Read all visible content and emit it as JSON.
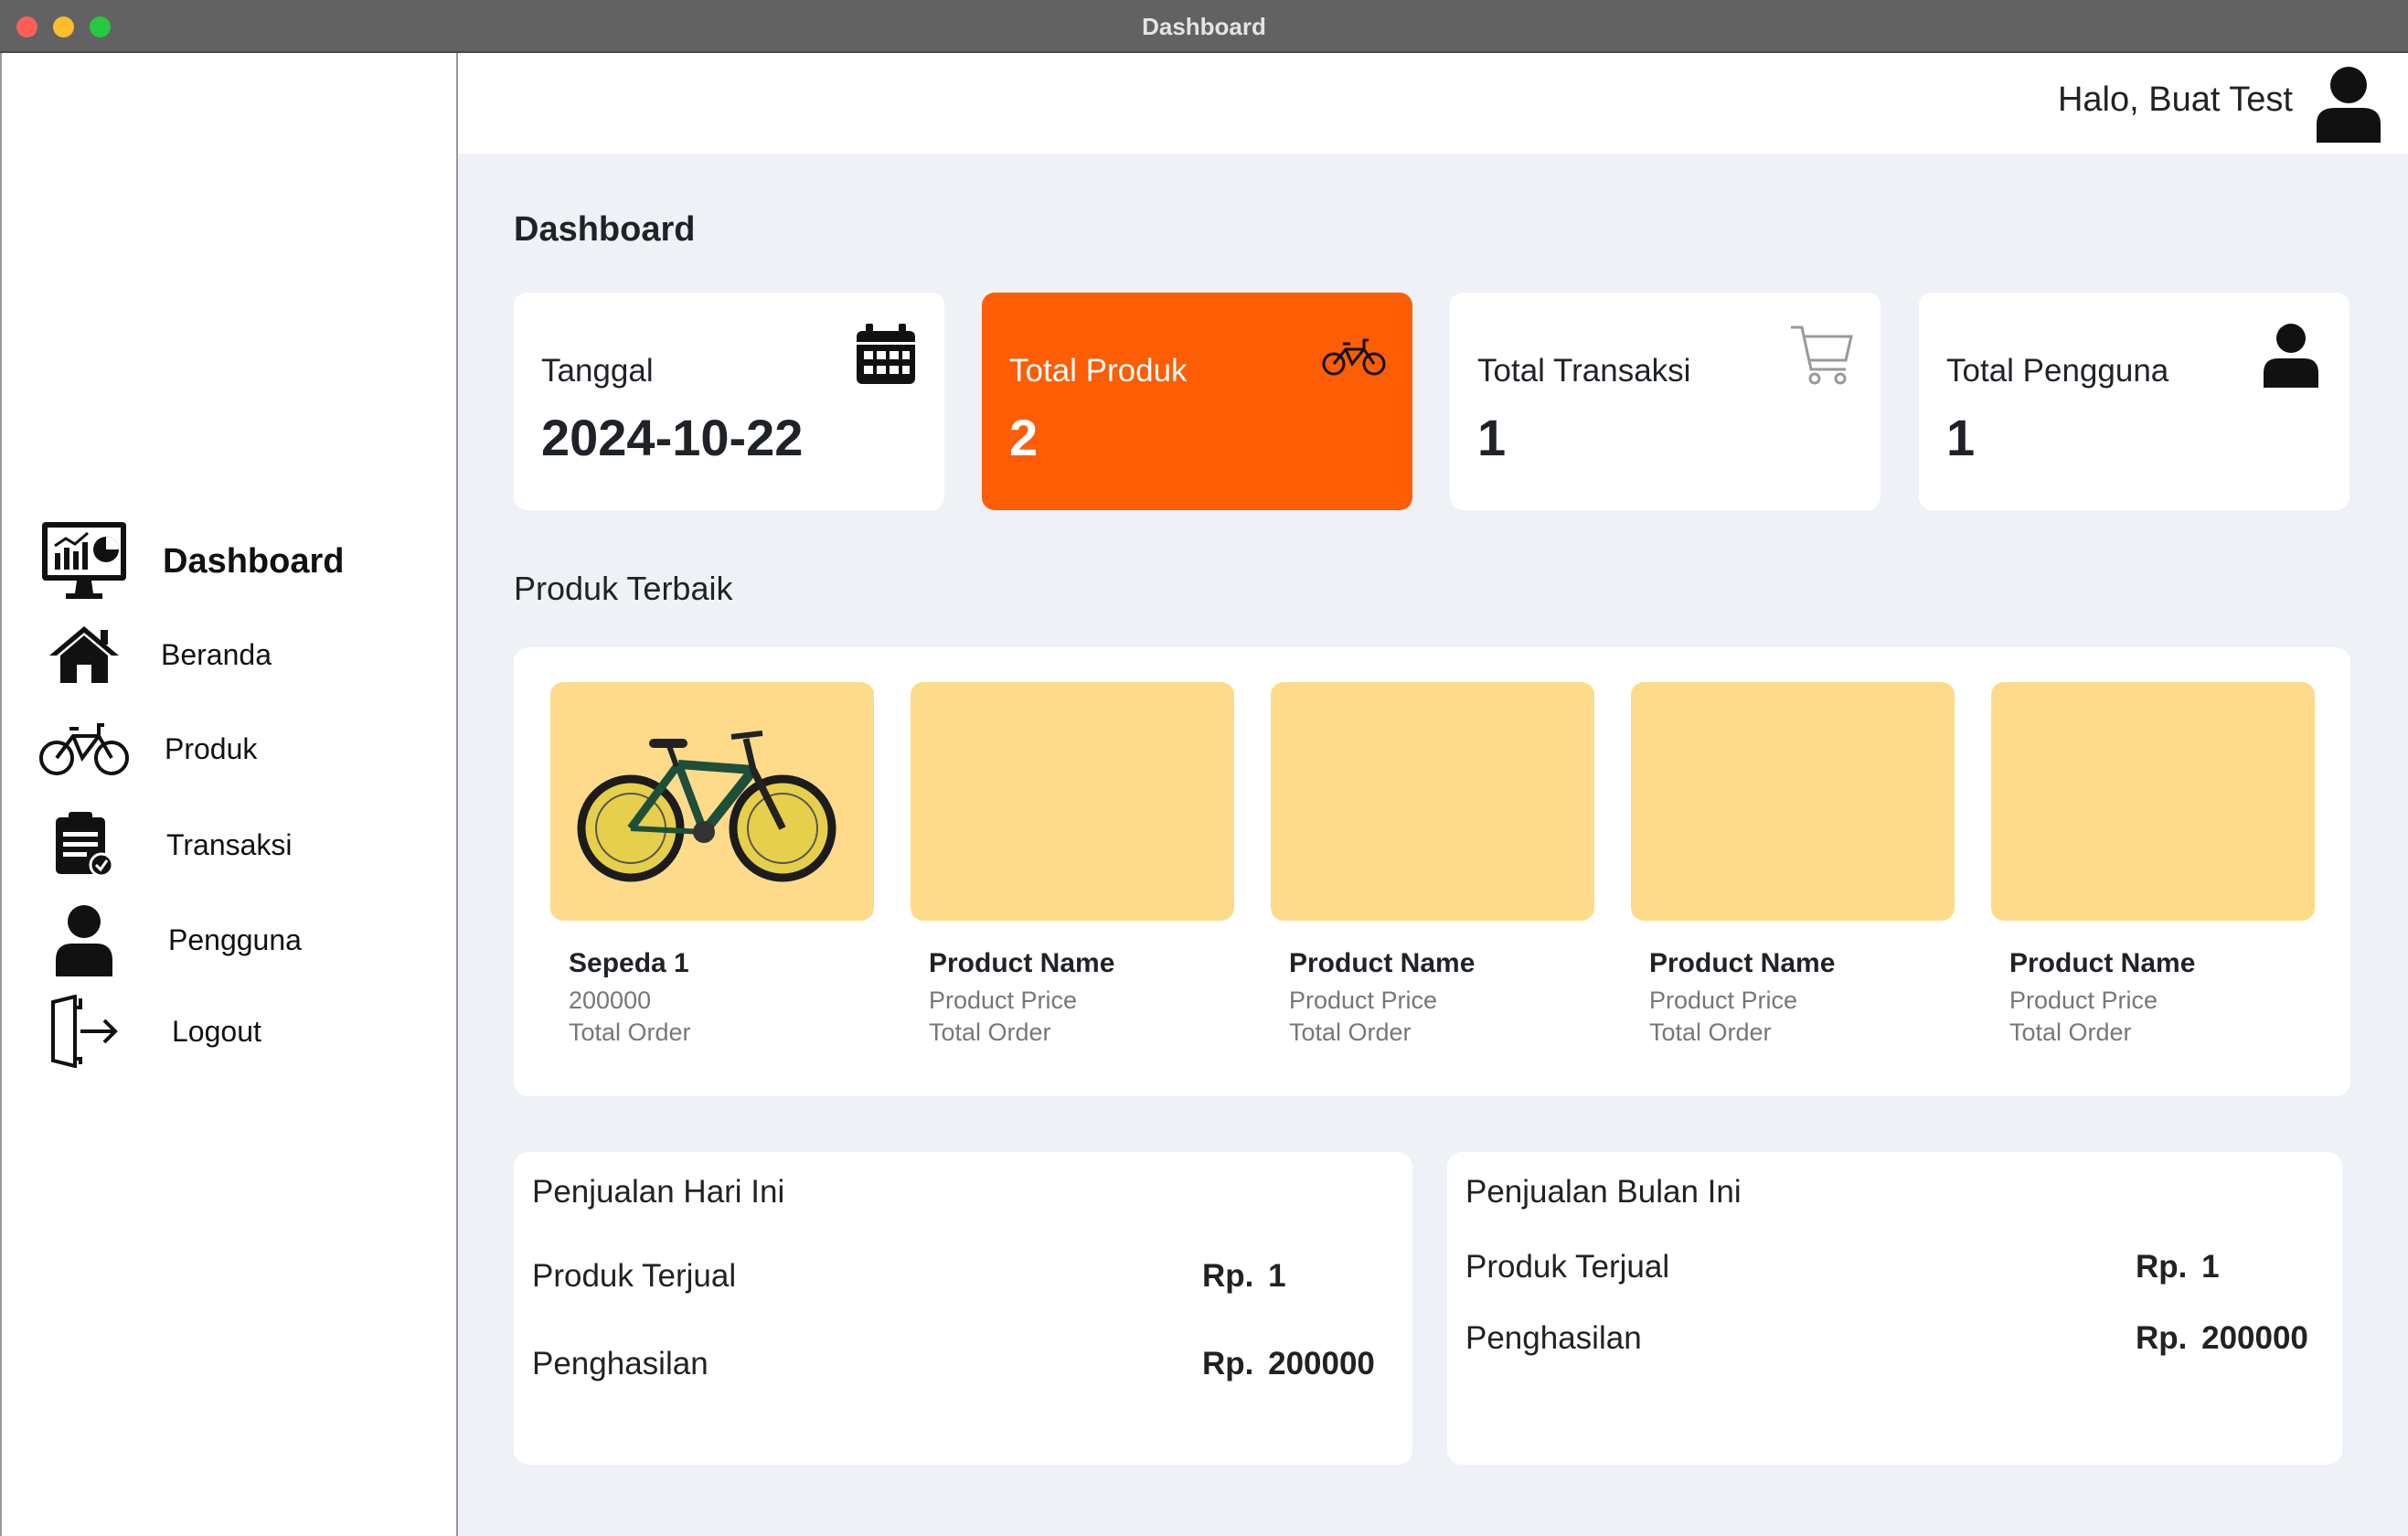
{
  "window": {
    "title": "Dashboard"
  },
  "header": {
    "greeting": "Halo, Buat Test"
  },
  "sidebar": {
    "items": [
      {
        "label": "Dashboard",
        "icon": "dashboard-monitor-icon",
        "active": true
      },
      {
        "label": "Beranda",
        "icon": "home-icon"
      },
      {
        "label": "Produk",
        "icon": "bicycle-icon"
      },
      {
        "label": "Transaksi",
        "icon": "clipboard-check-icon"
      },
      {
        "label": "Pengguna",
        "icon": "user-icon"
      },
      {
        "label": "Logout",
        "icon": "logout-door-icon"
      }
    ]
  },
  "page": {
    "title": "Dashboard"
  },
  "stats": [
    {
      "label": "Tanggal",
      "value": "2024-10-22",
      "icon": "calendar-icon"
    },
    {
      "label": "Total Produk",
      "value": "2",
      "icon": "bicycle-icon",
      "highlight": true
    },
    {
      "label": "Total Transaksi",
      "value": "1",
      "icon": "cart-icon"
    },
    {
      "label": "Total Pengguna",
      "value": "1",
      "icon": "user-icon"
    }
  ],
  "best_products": {
    "title": "Produk Terbaik",
    "items": [
      {
        "name": "Sepeda 1",
        "price": "200000",
        "order": "Total Order",
        "image": "bicycle-photo"
      },
      {
        "name": "Product Name",
        "price": "Product Price",
        "order": "Total Order"
      },
      {
        "name": "Product Name",
        "price": "Product Price",
        "order": "Total Order"
      },
      {
        "name": "Product Name",
        "price": "Product Price",
        "order": "Total Order"
      },
      {
        "name": "Product Name",
        "price": "Product Price",
        "order": "Total Order"
      }
    ]
  },
  "sales_today": {
    "title": "Penjualan Hari Ini",
    "sold_label": "Produk Terjual",
    "sold_value": "Rp. 1",
    "income_label": "Penghasilan",
    "income_value": "Rp. 200000"
  },
  "sales_month": {
    "title": "Penjualan Bulan Ini",
    "sold_label": "Produk Terjual",
    "sold_value": "Rp. 1",
    "income_label": "Penghasilan",
    "income_value": "Rp. 200000"
  },
  "colors": {
    "accent": "#fd5d04",
    "product_card": "#fddb8a",
    "background": "#eef1f5"
  }
}
